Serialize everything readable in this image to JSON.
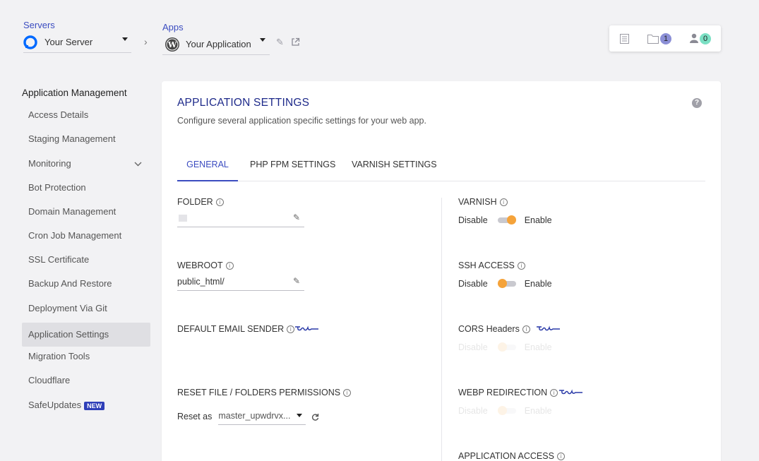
{
  "breadcrumb": {
    "servers_label": "Servers",
    "server_name": "Your Server",
    "apps_label": "Apps",
    "app_name": "Your Application"
  },
  "topbox": {
    "files_count": "1",
    "users_count": "0",
    "files_badge_color": "#8b8fd6",
    "users_badge_color": "#7be0c4"
  },
  "sidebar": {
    "title": "Application Management",
    "items": [
      {
        "label": "Access Details"
      },
      {
        "label": "Staging Management"
      },
      {
        "label": "Monitoring"
      },
      {
        "label": "Bot Protection"
      },
      {
        "label": "Domain Management"
      },
      {
        "label": "Cron Job Management"
      },
      {
        "label": "SSL Certificate"
      },
      {
        "label": "Backup And Restore"
      },
      {
        "label": "Deployment Via Git"
      },
      {
        "label": "Application Settings",
        "active": true
      },
      {
        "label": "Migration Tools"
      },
      {
        "label": "Cloudflare"
      },
      {
        "label": "SafeUpdates",
        "badge": "NEW"
      }
    ]
  },
  "panel": {
    "title": "APPLICATION SETTINGS",
    "subtitle": "Configure several application specific settings for your web app.",
    "help": "?",
    "tabs": [
      {
        "label": "GENERAL",
        "active": true
      },
      {
        "label": "PHP FPM SETTINGS"
      },
      {
        "label": "VARNISH SETTINGS"
      }
    ]
  },
  "left_fields": {
    "folder_label": "FOLDER",
    "folder_value": "",
    "webroot_label": "WEBROOT",
    "webroot_value": "public_html/",
    "email_sender_label": "DEFAULT EMAIL SENDER",
    "reset_label": "RESET FILE / FOLDERS PERMISSIONS",
    "reset_as": "Reset as",
    "reset_value": "master_upwdrvx..."
  },
  "right_fields": {
    "varnish_label": "VARNISH",
    "varnish_on": true,
    "ssh_label": "SSH ACCESS",
    "ssh_on": false,
    "cors_label": "CORS Headers",
    "webp_label": "WEBP REDIRECTION",
    "app_access_label": "APPLICATION ACCESS",
    "disable": "Disable",
    "enable": "Enable"
  },
  "colors": {
    "accent": "#3b4cc0",
    "title": "#1e2a8a",
    "toggle_knob": "#f5a33a"
  }
}
